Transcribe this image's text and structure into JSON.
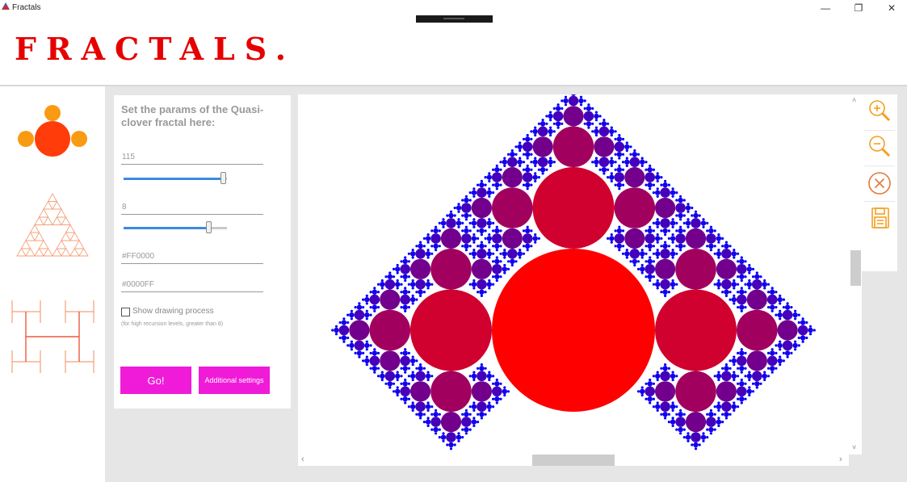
{
  "window": {
    "title": "Fractals",
    "minimize_glyph": "—",
    "restore_glyph": "❐",
    "close_glyph": "✕"
  },
  "header": {
    "logo": "FRACTALS."
  },
  "sidebar": {
    "items": [
      {
        "name": "Quasi-clover fractal",
        "icon": "quasi-clover-icon"
      },
      {
        "name": "Sierpinski triangle",
        "icon": "sierpinski-triangle-icon"
      },
      {
        "name": "H-tree fractal",
        "icon": "h-tree-icon"
      }
    ]
  },
  "params": {
    "title": "Set the params of the Quasi-clover fractal here:",
    "size_value": "115",
    "size_slider_fraction": 0.97,
    "recursion_value": "8",
    "recursion_slider_fraction": 0.83,
    "color1": "#FF0000",
    "color2": "#0000FF",
    "show_drawing_label": "Show drawing process",
    "show_drawing_checked": false,
    "hint": "(for high recursion levels, greater than 8)",
    "go_label": "Go!",
    "additional_label": "Additional settings"
  },
  "toolbar": {
    "items": [
      "zoom-in-icon",
      "zoom-out-icon",
      "clear-icon",
      "save-icon"
    ]
  },
  "scroll": {
    "up_arrow": "˄",
    "down_arrow": "˅",
    "left_arrow": "‹",
    "right_arrow": "›"
  },
  "colors": {
    "accent_logo": "#e60000",
    "button": "#f01bd8",
    "slider_fill": "#3a8be0",
    "fractal_large": "#ff0000",
    "fractal_small": "#0000ff",
    "icon_orange": "#f4a020"
  }
}
